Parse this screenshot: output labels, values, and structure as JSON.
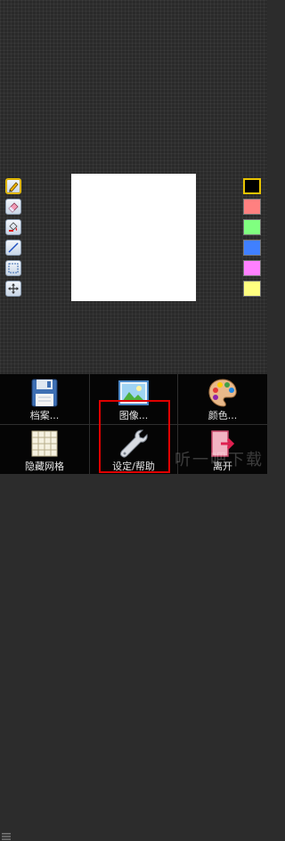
{
  "tools": [
    "pencil-icon",
    "eraser-icon",
    "fill-icon",
    "line-icon",
    "select-icon",
    "move-icon"
  ],
  "palette": {
    "colors": [
      "#000000",
      "#ff8080",
      "#80ff80",
      "#4080ff",
      "#ff80ff",
      "#ffff80"
    ],
    "selected_index": 0
  },
  "menu": {
    "file_label": "档案...",
    "image_label": "图像...",
    "color_label": "颜色...",
    "grid_label": "隐藏网格",
    "settings_label": "设定/帮助",
    "exit_label": "离开"
  },
  "watermark": "听一吧下载"
}
